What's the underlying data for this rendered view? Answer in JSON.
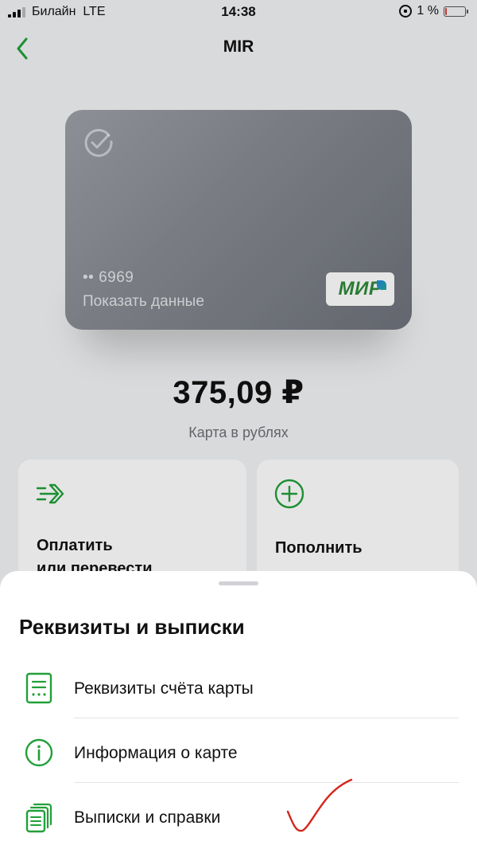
{
  "status_bar": {
    "carrier": "Билайн",
    "network": "LTE",
    "time": "14:38",
    "battery": "1 %",
    "battery_level_percent": 1,
    "battery_color": "#e53935"
  },
  "header": {
    "title": "MIR",
    "back_icon": "chevron-left-icon"
  },
  "card": {
    "masked_number": "•• 6969",
    "show_data_label": "Показать данные",
    "payment_system": "МИР",
    "logo_icon": "checkmark-circle-icon"
  },
  "balance": {
    "amount": "375,09 ₽",
    "caption": "Карта в рублях"
  },
  "actions": [
    {
      "label": "Оплатить\nили перевести",
      "icon": "transfer-arrow-icon"
    },
    {
      "label": "Пополнить",
      "icon": "plus-circle-icon"
    }
  ],
  "sheet": {
    "title": "Реквизиты и выписки",
    "items": [
      {
        "label": "Реквизиты счёта карты",
        "icon": "document-icon"
      },
      {
        "label": "Информация о карте",
        "icon": "info-icon"
      },
      {
        "label": "Выписки и справки",
        "icon": "documents-stack-icon"
      }
    ]
  },
  "colors": {
    "accent_green": "#21a038",
    "annotation_red": "#d3271b"
  }
}
